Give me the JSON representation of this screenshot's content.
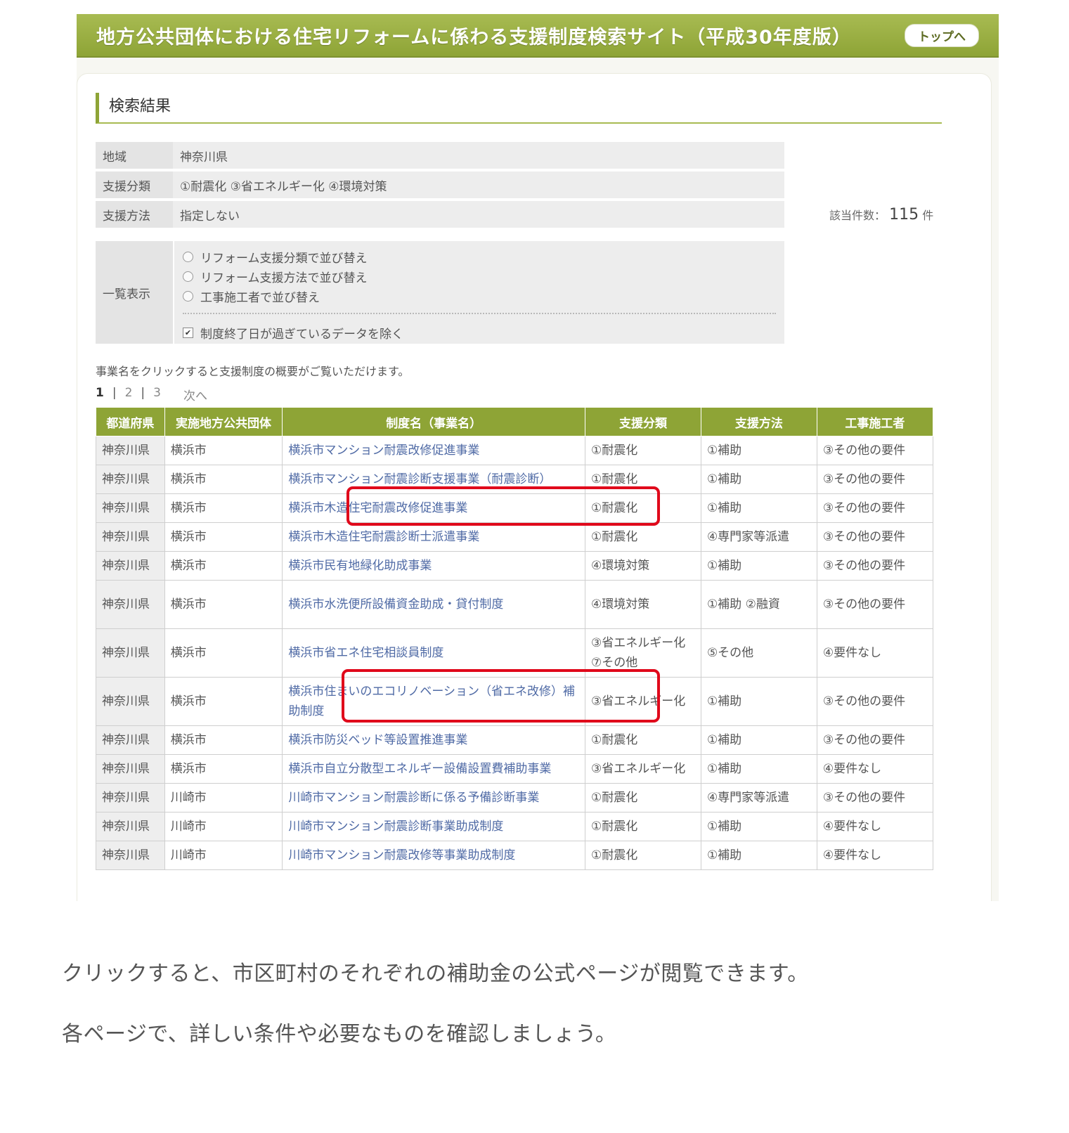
{
  "header": {
    "title": "地方公共団体における住宅リフォームに係わる支援制度検索サイト（平成30年度版）",
    "top_button": "トップへ"
  },
  "section_title": "検索結果",
  "conditions": [
    {
      "label": "地域",
      "value": "神奈川県"
    },
    {
      "label": "支援分類",
      "value": "①耐震化 ③省エネルギー化 ④環境対策"
    },
    {
      "label": "支援方法",
      "value": "指定しない"
    }
  ],
  "count": {
    "label": "該当件数：",
    "value": "115",
    "unit": "件"
  },
  "display": {
    "label": "一覧表示",
    "radios": [
      "リフォーム支援分類で並び替え",
      "リフォーム支援方法で並び替え",
      "工事施工者で並び替え"
    ],
    "checkbox": {
      "label": "制度終了日が過ぎているデータを除く",
      "checked": true
    }
  },
  "note": "事業名をクリックすると支援制度の概要がご覧いただけます。",
  "pager": {
    "pages": [
      "1",
      "2",
      "3"
    ],
    "sep": "|",
    "next": "次へ"
  },
  "table": {
    "headers": [
      "都道府県",
      "実施地方公共団体",
      "制度名（事業名）",
      "支援分類",
      "支援方法",
      "工事施工者"
    ],
    "rows": [
      [
        "神奈川県",
        "横浜市",
        "横浜市マンション耐震改修促進事業",
        "①耐震化",
        "①補助",
        "③その他の要件"
      ],
      [
        "神奈川県",
        "横浜市",
        "横浜市マンション耐震診断支援事業（耐震診断）",
        "①耐震化",
        "①補助",
        "③その他の要件"
      ],
      [
        "神奈川県",
        "横浜市",
        "横浜市木造住宅耐震改修促進事業",
        "①耐震化",
        "①補助",
        "③その他の要件"
      ],
      [
        "神奈川県",
        "横浜市",
        "横浜市木造住宅耐震診断士派遣事業",
        "①耐震化",
        "④専門家等派遣",
        "③その他の要件"
      ],
      [
        "神奈川県",
        "横浜市",
        "横浜市民有地緑化助成事業",
        "④環境対策",
        "①補助",
        "③その他の要件"
      ],
      [
        "神奈川県",
        "横浜市",
        "横浜市水洗便所設備資金助成・貸付制度",
        "④環境対策",
        "①補助 ②融資",
        "③その他の要件"
      ],
      [
        "神奈川県",
        "横浜市",
        "横浜市省エネ住宅相談員制度",
        "③省エネルギー化 ⑦その他",
        "⑤その他",
        "④要件なし"
      ],
      [
        "神奈川県",
        "横浜市",
        "横浜市住まいのエコリノベーション（省エネ改修）補助制度",
        "③省エネルギー化",
        "①補助",
        "③その他の要件"
      ],
      [
        "神奈川県",
        "横浜市",
        "横浜市防災ベッド等設置推進事業",
        "①耐震化",
        "①補助",
        "③その他の要件"
      ],
      [
        "神奈川県",
        "横浜市",
        "横浜市自立分散型エネルギー設備設置費補助事業",
        "③省エネルギー化",
        "①補助",
        "④要件なし"
      ],
      [
        "神奈川県",
        "川崎市",
        "川崎市マンション耐震診断に係る予備診断事業",
        "①耐震化",
        "④専門家等派遣",
        "③その他の要件"
      ],
      [
        "神奈川県",
        "川崎市",
        "川崎市マンション耐震診断事業助成制度",
        "①耐震化",
        "①補助",
        "④要件なし"
      ],
      [
        "神奈川県",
        "川崎市",
        "川崎市マンション耐震改修等事業助成制度",
        "①耐震化",
        "①補助",
        "④要件なし"
      ]
    ]
  },
  "captions": [
    "クリックすると、市区町村のそれぞれの補助金の公式ページが閲覧できます。",
    "各ページで、詳しい条件や必要なものを確認しましょう。"
  ],
  "colors": {
    "header_green": "#8ea436",
    "link_blue": "#4f6aa5",
    "highlight_red": "#e0091b"
  }
}
